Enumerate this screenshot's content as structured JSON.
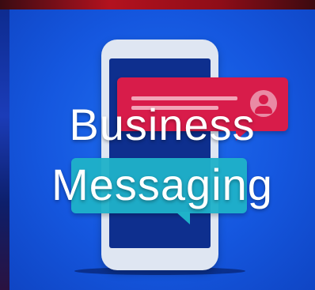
{
  "poster": {
    "title_line_1": "Business",
    "title_line_2": "Messaging"
  },
  "colors": {
    "background": "#1557df",
    "bubble_red": "#d81c4a",
    "bubble_teal": "#1fb2c9",
    "phone_body": "#dfe6f2",
    "phone_screen": "#0e2f8e",
    "text": "#ffffff"
  },
  "icons": [
    "smartphone-icon",
    "chat-bubble-icon",
    "user-avatar-icon"
  ]
}
